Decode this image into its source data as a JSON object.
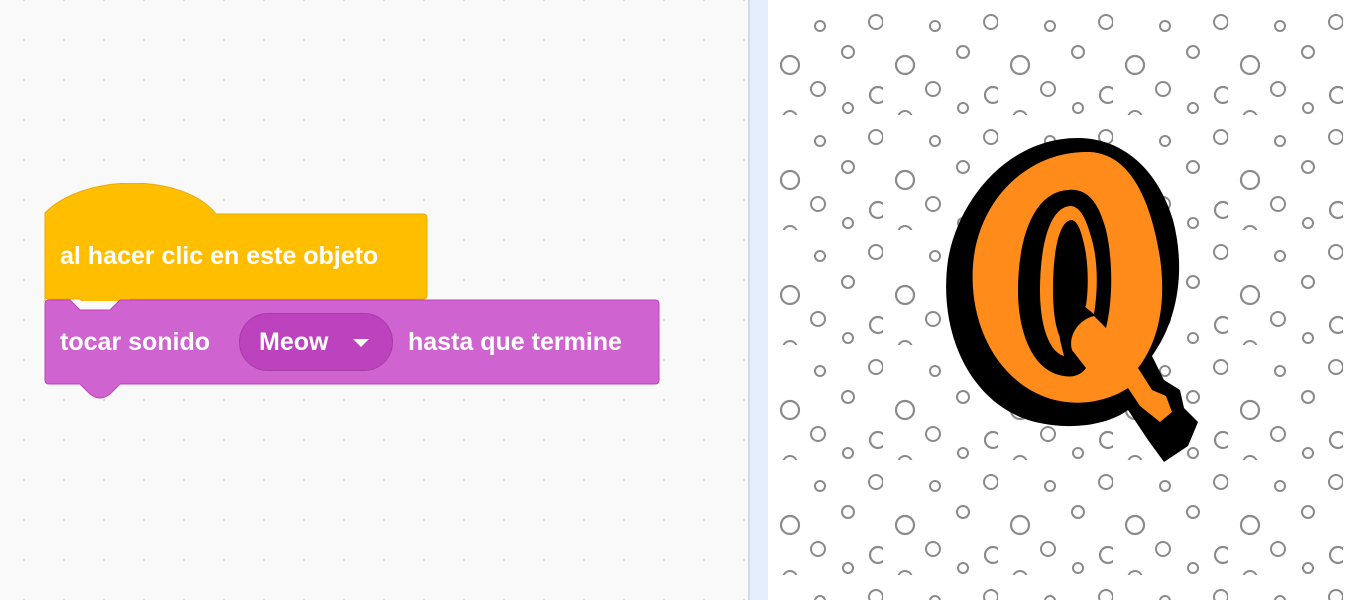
{
  "blocks": {
    "when_clicked": {
      "label": "al hacer clic en este objeto",
      "color": "#FFBF00"
    },
    "play_sound": {
      "prefix": "tocar sonido",
      "sound": "Meow",
      "suffix": "hasta que termine",
      "color": "#CF63CF"
    }
  },
  "stage": {
    "backdrop": "polka-dot-circles",
    "sprite": {
      "name": "letter-q",
      "fill_color": "#FF8C1A",
      "outline_color": "#000000"
    }
  }
}
